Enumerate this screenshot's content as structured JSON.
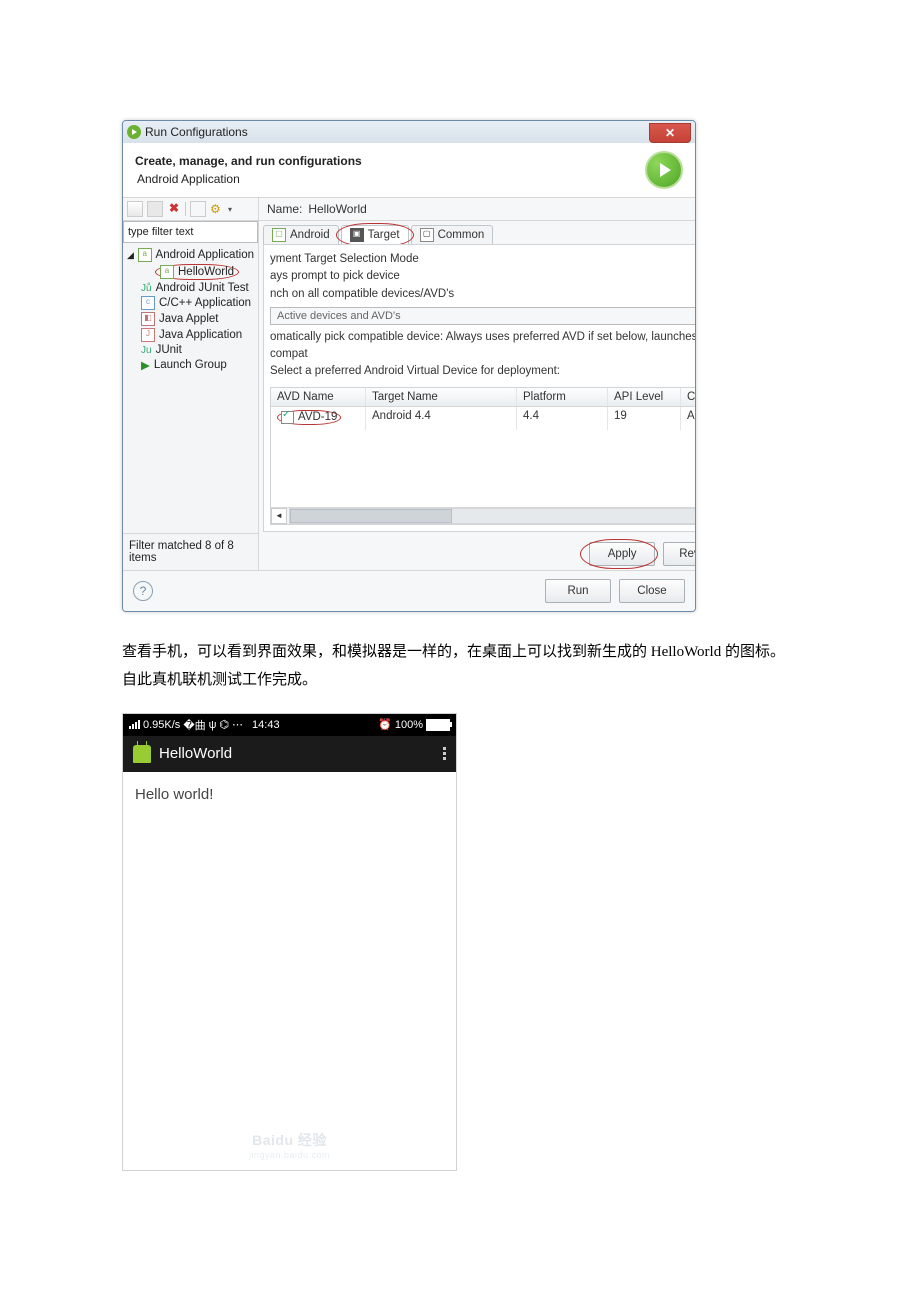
{
  "win": {
    "title": "Run Configurations",
    "close": "✕",
    "header_title": "Create, manage, and run configurations",
    "header_sub": "Android Application",
    "filter_placeholder": "type filter text",
    "tree": {
      "root": "Android Application",
      "hello": "HelloWorld",
      "junit_android": "Android JUnit Test",
      "cpp": "C/C++ Application",
      "applet": "Java Applet",
      "java_app": "Java Application",
      "junit": "JUnit",
      "launch_group": "Launch Group"
    },
    "filter_status": "Filter matched 8 of 8 items",
    "name_label": "Name:",
    "name_value": "HelloWorld",
    "tabs": {
      "android": "Android",
      "target": "Target",
      "common": "Common"
    },
    "panel": {
      "line1": "yment Target Selection Mode",
      "line2": "ays prompt to pick device",
      "line3": "nch on all compatible devices/AVD's",
      "dropdown": "Active devices and AVD's",
      "line4": "omatically pick compatible device: Always uses preferred AVD if set below, launches on compat",
      "line5": "Select a preferred Android Virtual Device for deployment:"
    },
    "table": {
      "headers": {
        "c1": "AVD Name",
        "c2": "Target Name",
        "c3": "Platform",
        "c4": "API Level",
        "c5": "CPU/A"
      },
      "row": {
        "c1": "AVD-19",
        "c2": "Android 4.4",
        "c3": "4.4",
        "c4": "19",
        "c5": "ARM"
      }
    },
    "buttons": {
      "apply": "Apply",
      "revert": "Revert",
      "run": "Run",
      "close": "Close"
    }
  },
  "paragraph": "查看手机，可以看到界面效果，和模拟器是一样的，在桌面上可以找到新生成的 HelloWorld 的图标。自此真机联机测试工作完成。",
  "phone": {
    "status": {
      "speed": "0.95K/s",
      "time": "14:43",
      "battery": "100%"
    },
    "appbar_title": "HelloWorld",
    "body_text": "Hello world!",
    "watermark": "Baidu 经验",
    "watermark_sub": "jingyan.baidu.com"
  }
}
